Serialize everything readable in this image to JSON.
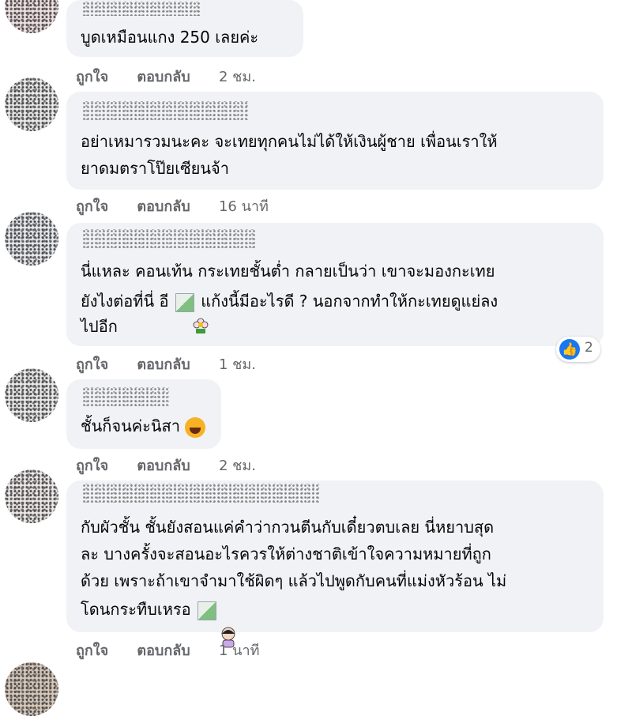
{
  "comments": [
    {
      "text_lines": [
        "บูดเหมือนแกง 250 เลยค่ะ"
      ],
      "actions": {
        "like": "ถูกใจ",
        "reply": "ตอบกลับ",
        "time": "2 ชม."
      }
    },
    {
      "text_lines": [
        "อย่าเหมารวมนะคะ จะเทยทุกคนไม่ได้ให้เงินผู้ชาย เพื่อนเราให้",
        "ยาดมตราโป๊ยเซียนจ้า"
      ],
      "actions": {
        "like": "ถูกใจ",
        "reply": "ตอบกลับ",
        "time": "16 นาที"
      }
    },
    {
      "text_lines": [
        "นี่แหละ คอนเท้น กระเทยชั้นต่ำ กลายเป็นว่า เขาจะมองกะเทย",
        "ยังไงต่อที่นี่ อี",
        "แก้งนี้มีอะไรดี ? นอกจากทำให้กะเทยดูแย่ลง",
        "ไปอีก"
      ],
      "reaction_count": "2",
      "actions": {
        "like": "ถูกใจ",
        "reply": "ตอบกลับ",
        "time": "1 ชม."
      }
    },
    {
      "text_lines": [
        "ชั้นก็จนค่ะนิสา"
      ],
      "actions": {
        "like": "ถูกใจ",
        "reply": "ตอบกลับ",
        "time": "2 ชม."
      }
    },
    {
      "text_lines": [
        "กับผัวชั้น ชั้นยังสอนแค่คำว่ากวนตีนกับเดี๋ยวตบเลย นี่หยาบสุด",
        "ละ บางครั้งจะสอนอะไรควรให้ต่างชาติเข้าใจความหมายที่ถูก",
        "ด้วย เพราะถ้าเขาจำมาใช้ผิดๆ แล้วไปพูดกับคนที่แม่งหัวร้อน ไม่",
        "โดนกระทืบเหรอ"
      ],
      "actions": {
        "like": "ถูกใจ",
        "reply": "ตอบกลับ",
        "time": "1 นาที"
      }
    }
  ],
  "colors": {
    "bubble": "#f0f2f5",
    "action_text": "#65676b",
    "like_blue": "#1877f2"
  },
  "icons": [
    "like-icon",
    "laugh-emoji-icon",
    "flower-emoji-icon",
    "broken-image-icon",
    "sticker-icon"
  ]
}
